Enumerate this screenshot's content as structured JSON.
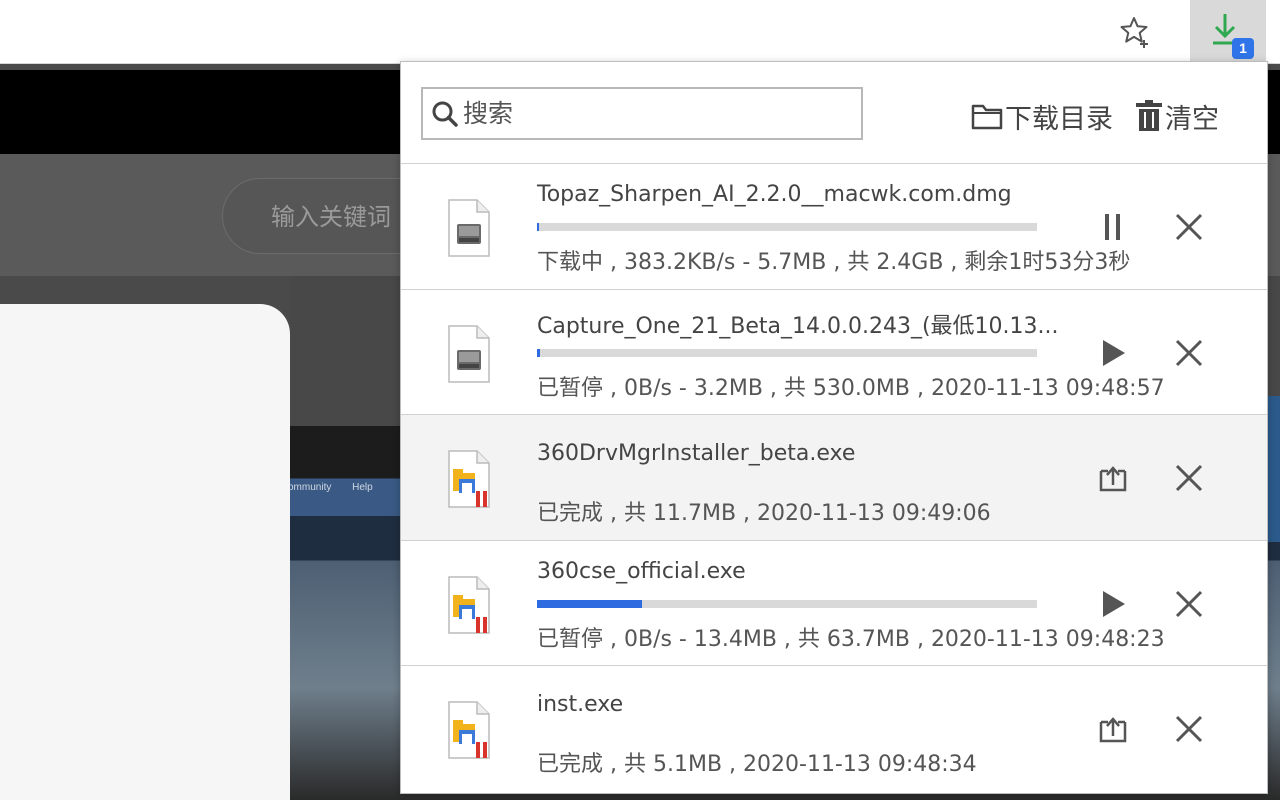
{
  "background_page": {
    "search_placeholder": "输入关键词",
    "menu_items": [
      "ommunity",
      "Help"
    ]
  },
  "toolbar": {
    "star_icon": "star-add-icon",
    "extension_icon": "download-arrow-icon",
    "badge_count": "1",
    "accent_color": "#2f74e8",
    "extension_icon_color": "#2fa84f"
  },
  "popup": {
    "search": {
      "placeholder": "搜索",
      "value": ""
    },
    "download_dir_label": "下载目录",
    "clear_label": "清空",
    "progress_color": "#2f6be0",
    "items": [
      {
        "filename": "Topaz_Sharpen_AI_2.2.0__macwk.com.dmg",
        "file_type": "dmg",
        "progress": 0.002,
        "status": "下载中 , 383.2KB/s - 5.7MB , 共 2.4GB , 剩余1时53分3秒",
        "action": "pause-icon"
      },
      {
        "filename": "Capture_One_21_Beta_14.0.0.243_(最低10.13...",
        "file_type": "dmg",
        "progress": 0.006,
        "status": "已暂停 , 0B/s - 3.2MB , 共 530.0MB , 2020-11-13 09:48:57",
        "action": "play-icon"
      },
      {
        "filename": "360DrvMgrInstaller_beta.exe",
        "file_type": "exe",
        "progress": null,
        "status": "已完成 , 共 11.7MB , 2020-11-13 09:49:06",
        "action": "open-folder-icon"
      },
      {
        "filename": "360cse_official.exe",
        "file_type": "exe",
        "progress": 0.21,
        "status": "已暂停 , 0B/s - 13.4MB , 共 63.7MB , 2020-11-13 09:48:23",
        "action": "play-icon"
      },
      {
        "filename": "inst.exe",
        "file_type": "exe",
        "progress": null,
        "status": "已完成 , 共 5.1MB , 2020-11-13 09:48:34",
        "action": "open-folder-icon"
      }
    ]
  }
}
